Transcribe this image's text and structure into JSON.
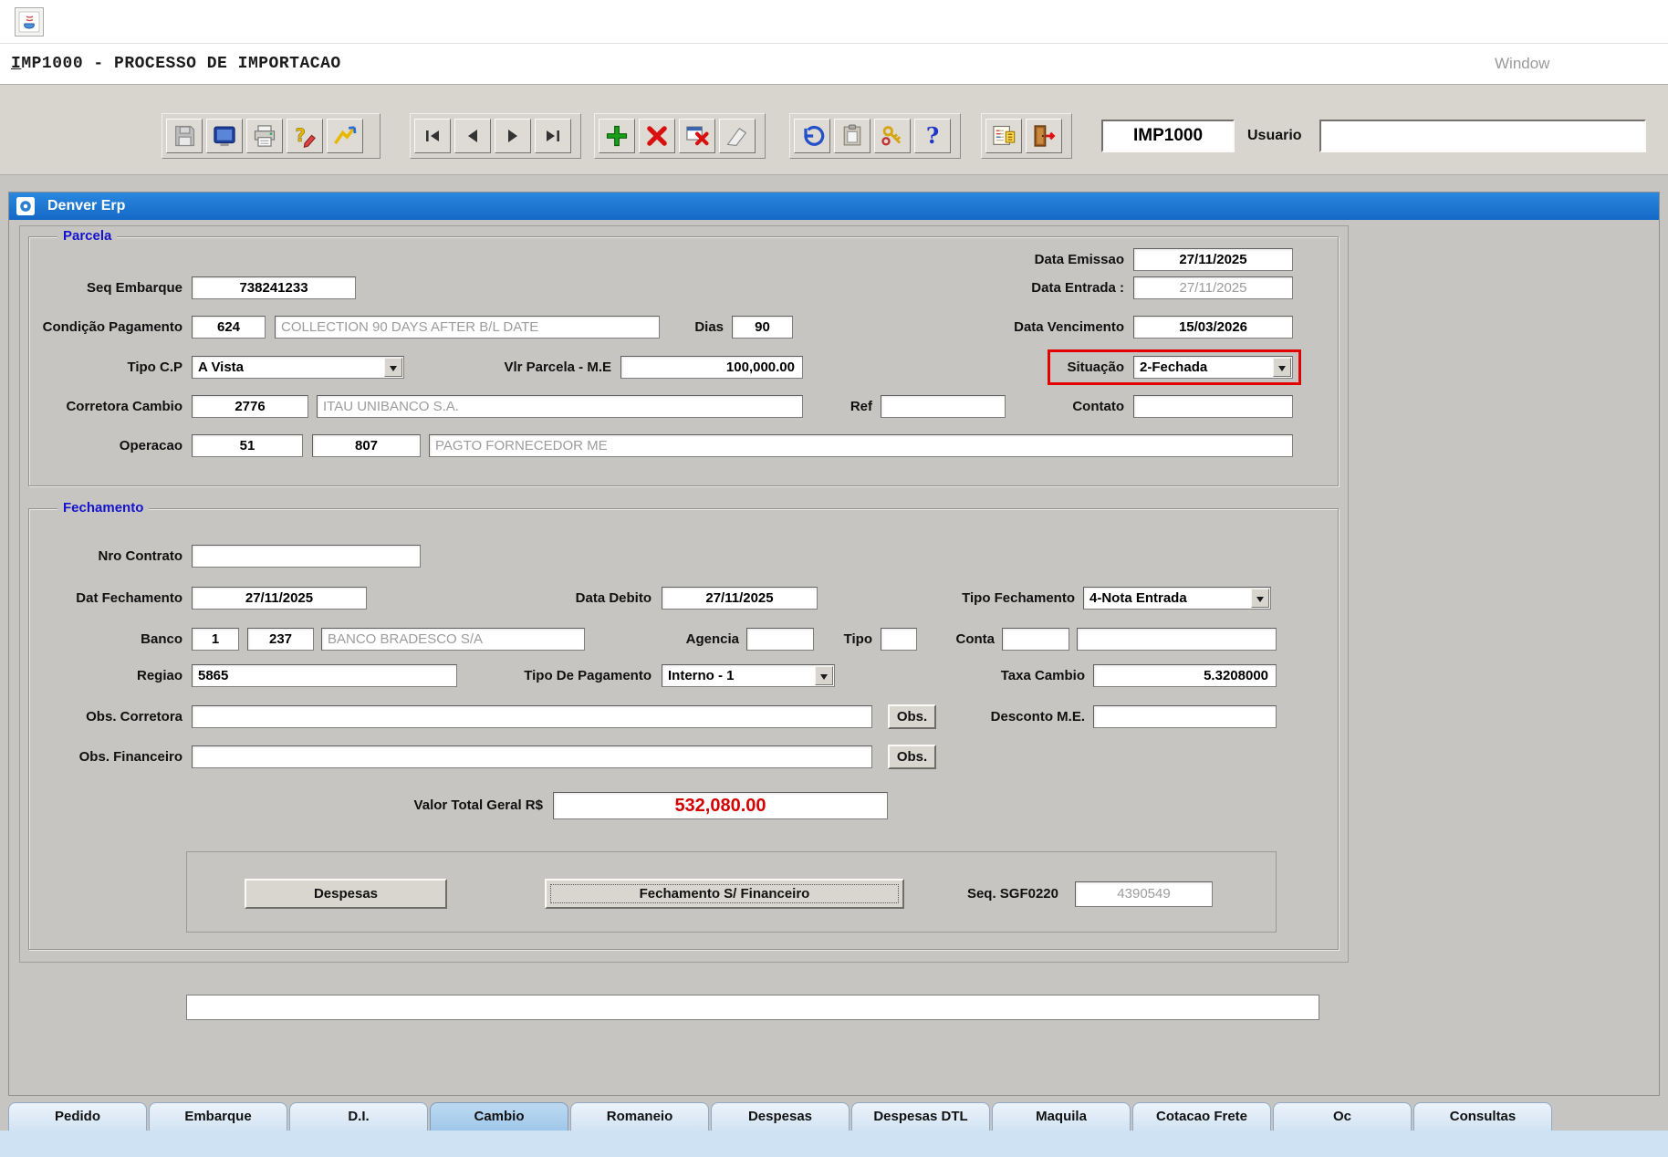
{
  "app": {
    "window_title": "IMP1000 - PROCESSO DE IMPORTACAO",
    "window_menu": "Window",
    "titlebar": "Denver Erp"
  },
  "toolbar": {
    "program_code": "IMP1000",
    "usuario": {
      "label": "Usuario",
      "value": ""
    },
    "icon_names": [
      "save",
      "screen",
      "print",
      "help-edit",
      "help-wizard",
      "nav-first",
      "nav-previous",
      "nav-next",
      "nav-last",
      "add-record",
      "delete-record",
      "cancel-grid",
      "clear",
      "undo",
      "paste",
      "keys",
      "help",
      "schedule",
      "exit"
    ]
  },
  "parcela": {
    "title": "Parcela",
    "data_emissao": {
      "label": "Data Emissao",
      "value": "27/11/2025"
    },
    "seq_embarque": {
      "label": "Seq Embarque",
      "value": "738241233"
    },
    "data_entrada": {
      "label": "Data Entrada :",
      "value": "27/11/2025"
    },
    "condicao_pagamento": {
      "label": "Condição Pagamento",
      "code": "624",
      "description": "COLLECTION 90 DAYS AFTER B/L DATE"
    },
    "dias": {
      "label": "Dias",
      "value": "90"
    },
    "data_vencimento": {
      "label": "Data Vencimento",
      "value": "15/03/2026"
    },
    "tipo_cp": {
      "label": "Tipo C.P",
      "value": "A Vista"
    },
    "vlr_parcela": {
      "label": "Vlr Parcela - M.E",
      "value": "100,000.00"
    },
    "situacao": {
      "label": "Situação",
      "value": "2-Fechada"
    },
    "corretora_cambio": {
      "label": "Corretora Cambio",
      "code": "2776",
      "description": "ITAU UNIBANCO S.A."
    },
    "ref": {
      "label": "Ref",
      "value": ""
    },
    "contato": {
      "label": "Contato",
      "value": ""
    },
    "operacao": {
      "label": "Operacao",
      "code1": "51",
      "code2": "807",
      "description": "PAGTO FORNECEDOR ME"
    }
  },
  "fechamento": {
    "title": "Fechamento",
    "nro_contrato": {
      "label": "Nro Contrato",
      "value": ""
    },
    "dat_fechamento": {
      "label": "Dat Fechamento",
      "value": "27/11/2025"
    },
    "data_debito": {
      "label": "Data Debito",
      "value": "27/11/2025"
    },
    "tipo_fechamento": {
      "label": "Tipo Fechamento",
      "value": "4-Nota Entrada"
    },
    "banco": {
      "label": "Banco",
      "code1": "1",
      "code2": "237",
      "description": "BANCO BRADESCO S/A"
    },
    "agencia": {
      "label": "Agencia",
      "value": ""
    },
    "tipo": {
      "label": "Tipo",
      "value": ""
    },
    "conta": {
      "label": "Conta",
      "value1": "",
      "value2": ""
    },
    "regiao": {
      "label": "Regiao",
      "value": "5865"
    },
    "tipo_pagamento": {
      "label": "Tipo De Pagamento",
      "value": "Interno - 1"
    },
    "taxa_cambio": {
      "label": "Taxa Cambio",
      "value": "5.3208000"
    },
    "obs_corretora": {
      "label": "Obs. Corretora",
      "value": "",
      "button": "Obs."
    },
    "desconto_me": {
      "label": "Desconto M.E.",
      "value": ""
    },
    "obs_financeiro": {
      "label": "Obs. Financeiro",
      "value": "",
      "button": "Obs."
    },
    "valor_total": {
      "label": "Valor Total Geral R$",
      "value": "532,080.00"
    },
    "despesas_button": "Despesas",
    "fechamento_financeiro_button": "Fechamento S/ Financeiro",
    "seq_sgf": {
      "label": "Seq. SGF0220",
      "value": "4390549"
    }
  },
  "status_message": "",
  "tabs": {
    "selected": "Cambio",
    "items": [
      {
        "label": "Pedido"
      },
      {
        "label": "Embarque"
      },
      {
        "label": "D.I."
      },
      {
        "label": "Cambio"
      },
      {
        "label": "Romaneio"
      },
      {
        "label": "Despesas"
      },
      {
        "label": "Despesas DTL"
      },
      {
        "label": "Maquila"
      },
      {
        "label": "Cotacao Frete"
      },
      {
        "label": "Oc"
      },
      {
        "label": "Consultas"
      }
    ]
  },
  "colors": {
    "titlebar_blue": "#1a78d4",
    "highlight_red": "#e30000",
    "total_value_red": "#d40000",
    "selected_tab_blue": "#aed0ec",
    "group_title_blue": "#1414cc"
  }
}
